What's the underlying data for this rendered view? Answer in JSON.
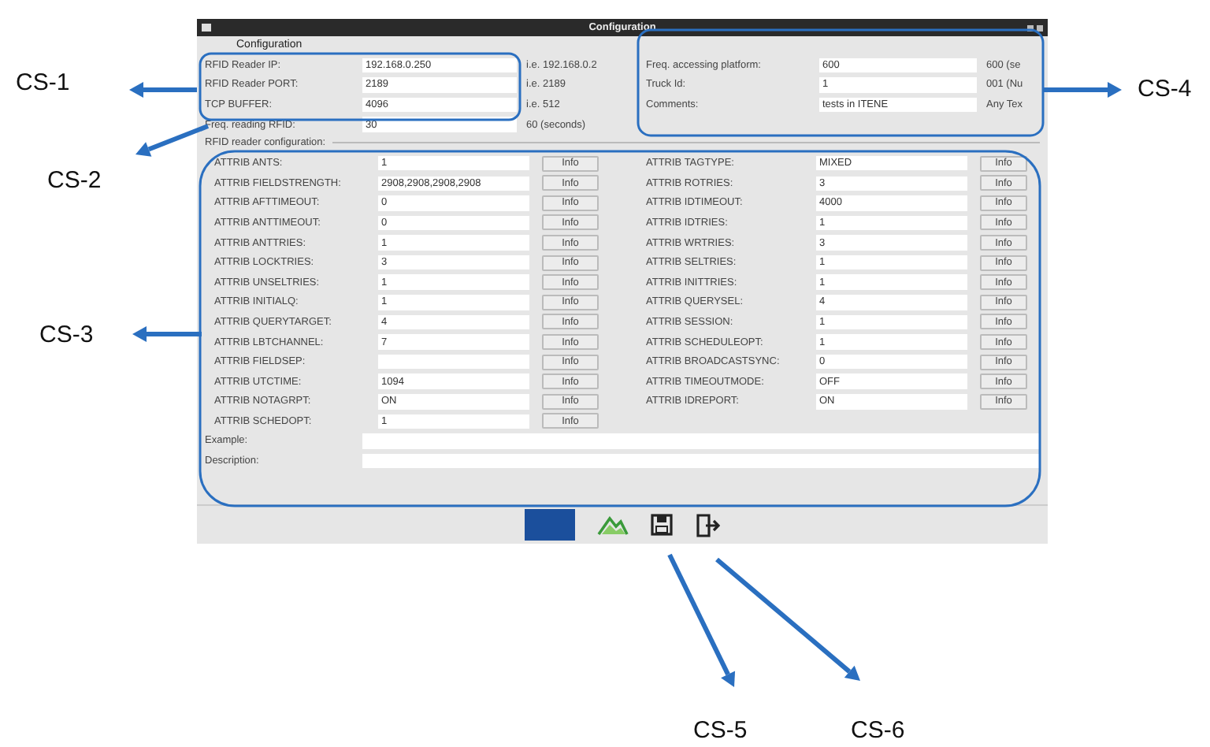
{
  "window": {
    "title": "Configuration"
  },
  "config_group": {
    "title": "Configuration"
  },
  "left_fields": [
    {
      "label": "RFID Reader IP:",
      "value": "192.168.0.250",
      "hint": "i.e. 192.168.0.2"
    },
    {
      "label": "RFID Reader PORT:",
      "value": "2189",
      "hint": "i.e. 2189"
    },
    {
      "label": "TCP BUFFER:",
      "value": "4096",
      "hint": "i.e. 512"
    },
    {
      "label": "Freq. reading RFID:",
      "value": "30",
      "hint": "60 (seconds)"
    }
  ],
  "right_fields": [
    {
      "label": "Freq. accessing platform:",
      "value": "600",
      "hint": "600 (se"
    },
    {
      "label": "Truck Id:",
      "value": "1",
      "hint": "001 (Nu"
    },
    {
      "label": "Comments:",
      "value": "tests in ITENE",
      "hint": "Any Tex"
    }
  ],
  "rfid_section": {
    "title": "RFID reader configuration:"
  },
  "attributes_left": [
    {
      "label": "ATTRIB ANTS:",
      "value": "1",
      "button": "Info"
    },
    {
      "label": "ATTRIB FIELDSTRENGTH:",
      "value": "2908,2908,2908,2908",
      "button": "Info"
    },
    {
      "label": "ATTRIB AFTTIMEOUT:",
      "value": "0",
      "button": "Info"
    },
    {
      "label": "ATTRIB ANTTIMEOUT:",
      "value": "0",
      "button": "Info"
    },
    {
      "label": "ATTRIB ANTTRIES:",
      "value": "1",
      "button": "Info"
    },
    {
      "label": "ATTRIB LOCKTRIES:",
      "value": "3",
      "button": "Info"
    },
    {
      "label": "ATTRIB UNSELTRIES:",
      "value": "1",
      "button": "Info"
    },
    {
      "label": "ATTRIB INITIALQ:",
      "value": "1",
      "button": "Info"
    },
    {
      "label": "ATTRIB QUERYTARGET:",
      "value": "4",
      "button": "Info"
    },
    {
      "label": "ATTRIB LBTCHANNEL:",
      "value": "7",
      "button": "Info"
    },
    {
      "label": "ATTRIB FIELDSEP:",
      "button": "Info"
    },
    {
      "label": "ATTRIB UTCTIME:",
      "value": "1094",
      "button": "Info"
    },
    {
      "label": "ATTRIB NOTAGRPT:",
      "value": "ON",
      "button": "Info"
    },
    {
      "label": "ATTRIB SCHEDOPT:",
      "value": "1",
      "button": "Info"
    }
  ],
  "attributes_right": [
    {
      "label": "ATTRIB TAGTYPE:",
      "value": "MIXED",
      "button": "Info"
    },
    {
      "label": "ATTRIB ROTRIES:",
      "value": "3",
      "button": "Info"
    },
    {
      "label": "ATTRIB IDTIMEOUT:",
      "value": "4000",
      "button": "Info"
    },
    {
      "label": "ATTRIB IDTRIES:",
      "value": "1",
      "button": "Info"
    },
    {
      "label": "ATTRIB WRTRIES:",
      "value": "3",
      "button": "Info"
    },
    {
      "label": "ATTRIB SELTRIES:",
      "value": "1",
      "button": "Info"
    },
    {
      "label": "ATTRIB INITTRIES:",
      "value": "1",
      "button": "Info"
    },
    {
      "label": "ATTRIB QUERYSEL:",
      "value": "4",
      "button": "Info"
    },
    {
      "label": "ATTRIB SESSION:",
      "value": "1",
      "button": "Info"
    },
    {
      "label": "ATTRIB SCHEDULEOPT:",
      "value": "1",
      "button": "Info"
    },
    {
      "label": "ATTRIB BROADCASTSYNC:",
      "value": "0",
      "button": "Info"
    },
    {
      "label": "ATTRIB TIMEOUTMODE:",
      "value": "OFF",
      "button": "Info"
    },
    {
      "label": "ATTRIB IDREPORT:",
      "value": "ON",
      "button": "Info"
    }
  ],
  "bottom_fields": [
    {
      "label": "Example:"
    },
    {
      "label": "Description:"
    }
  ],
  "toolbar": [
    {
      "kind": "flag"
    },
    {
      "kind": "mountain"
    },
    {
      "kind": "save"
    },
    {
      "kind": "exit"
    }
  ],
  "callouts": [
    {
      "label": "CS-1"
    },
    {
      "label": "CS-2"
    },
    {
      "label": "CS-3"
    },
    {
      "label": "CS-4"
    },
    {
      "label": "CS-5"
    },
    {
      "label": "CS-6"
    }
  ]
}
